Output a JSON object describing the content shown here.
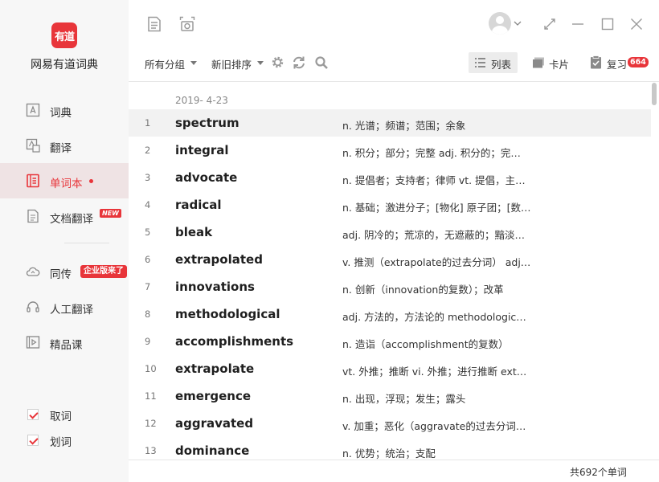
{
  "app": {
    "logo_text": "有道",
    "name": "网易有道词典"
  },
  "sidebar": {
    "items": [
      {
        "label": "词典"
      },
      {
        "label": "翻译"
      },
      {
        "label": "单词本"
      },
      {
        "label": "文档翻译",
        "badge": "NEW"
      },
      {
        "label": "同传",
        "badge": "企业版来了"
      },
      {
        "label": "人工翻译"
      },
      {
        "label": "精品课"
      }
    ],
    "toggles": [
      {
        "label": "取词",
        "checked": true
      },
      {
        "label": "划词",
        "checked": true
      }
    ]
  },
  "toolbar": {
    "group_filter": "所有分组",
    "sort_order": "新旧排序",
    "view_list": "列表",
    "view_card": "卡片",
    "review": "复习",
    "review_count": "664"
  },
  "list": {
    "date": "2019- 4-23",
    "rows": [
      {
        "num": "1",
        "word": "spectrum",
        "def": "n. 光谱；频谱；范围；余象"
      },
      {
        "num": "2",
        "word": "integral",
        "def": "n. 积分；部分；完整  adj. 积分的；完…"
      },
      {
        "num": "3",
        "word": "advocate",
        "def": "n. 提倡者；支持者；律师  vt. 提倡，主…"
      },
      {
        "num": "4",
        "word": "radical",
        "def": "n. 基础；激进分子；[物化] 原子团；[数…"
      },
      {
        "num": "5",
        "word": "bleak",
        "def": "adj. 阴冷的；荒凉的，无遮蔽的；黯淡…"
      },
      {
        "num": "6",
        "word": "extrapolated",
        "def": "v. 推测（extrapolate的过去分词）  adj…"
      },
      {
        "num": "7",
        "word": "innovations",
        "def": "n. 创新（innovation的复数）；改革"
      },
      {
        "num": "8",
        "word": "methodological",
        "def": "adj. 方法的，方法论的  methodologic…"
      },
      {
        "num": "9",
        "word": "accomplishments",
        "def": "n. 造诣（accomplishment的复数）"
      },
      {
        "num": "10",
        "word": "extrapolate",
        "def": "vt. 外推；推断  vi. 外推；进行推断  ext…"
      },
      {
        "num": "11",
        "word": "emergence",
        "def": "n. 出现，浮现；发生；露头"
      },
      {
        "num": "12",
        "word": "aggravated",
        "def": "v. 加重；恶化（aggravate的过去分词…"
      },
      {
        "num": "13",
        "word": "dominance",
        "def": "n. 优势；统治；支配"
      }
    ],
    "total": "共692个单词"
  },
  "colors": {
    "accent": "#e8353a",
    "sidebar_bg": "#f7f7f7",
    "active_bg": "#efe3e4"
  }
}
